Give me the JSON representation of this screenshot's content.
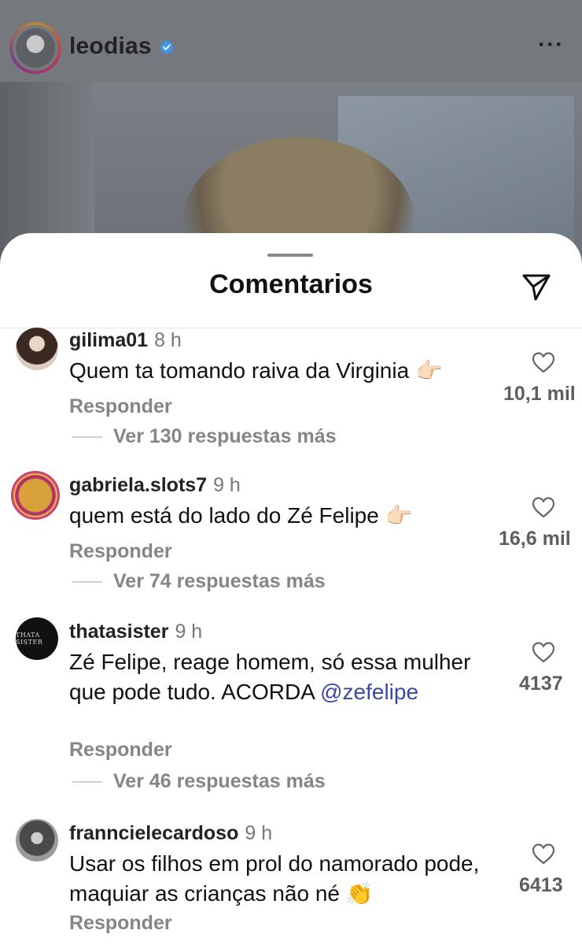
{
  "post": {
    "username": "leodias",
    "more_label": "···"
  },
  "sheet": {
    "title": "Comentarios"
  },
  "comments": [
    {
      "username": "gilima01",
      "time": "8 h",
      "text": "Quem ta tomando raiva da Virginia 👉🏻",
      "reply_label": "Responder",
      "more_replies": "Ver 130 respuestas más",
      "likes": "10,1 mil"
    },
    {
      "username": "gabriela.slots7",
      "time": "9 h",
      "text": "quem está do lado do Zé Felipe 👉🏻",
      "reply_label": "Responder",
      "more_replies": "Ver 74 respuestas más",
      "likes": "16,6 mil"
    },
    {
      "username": "thatasister",
      "time": "9 h",
      "text": "Zé Felipe, reage homem, só essa mulher que pode tudo. ACORDA",
      "mention": "@zefelipe",
      "avatar_text": "THATA SISTER",
      "reply_label": "Responder",
      "more_replies": "Ver 46 respuestas más",
      "likes": "4137"
    },
    {
      "username": "franncielecardoso",
      "time": "9 h",
      "text": "Usar os filhos em prol do namorado pode, maquiar as crianças não né 👏",
      "reply_label": "Responder",
      "likes": "6413"
    }
  ],
  "colors": {
    "verified": "#3897f0",
    "mention": "#3a49a8",
    "secondary_text": "#858585"
  },
  "icons": {
    "share": "paper-plane-icon",
    "like": "heart-outline-icon"
  }
}
